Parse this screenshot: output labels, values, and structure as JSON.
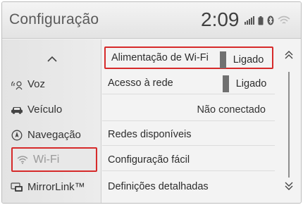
{
  "header": {
    "title": "Configuração",
    "clock": "2:09",
    "status_icons": [
      "signal-bars-icon",
      "battery-icon",
      "bluetooth-icon",
      "wifi-icon"
    ]
  },
  "sidebar": {
    "up_icon": "chevron-up-icon",
    "items": [
      {
        "label": "Voz",
        "icon": "voice-icon",
        "active": false
      },
      {
        "label": "Veículo",
        "icon": "car-icon",
        "active": false
      },
      {
        "label": "Navegação",
        "icon": "navigation-icon",
        "active": false
      },
      {
        "label": "Wi-Fi",
        "icon": "wifi-icon",
        "active": true
      },
      {
        "label": "MirrorLink™",
        "icon": "mirrorlink-icon",
        "active": false
      }
    ]
  },
  "list": {
    "rows": [
      {
        "label": "Alimentação de Wi-Fi",
        "toggle": "Ligado"
      },
      {
        "label": "Acesso à rede",
        "toggle": "Ligado"
      },
      {
        "label": "",
        "status": "Não conectado"
      },
      {
        "label": "Redes disponíveis"
      },
      {
        "label": "Configuração fácil"
      },
      {
        "label": "Definições detalhadas"
      }
    ]
  },
  "scroll": {
    "up_icon": "double-chevron-up-icon",
    "down_icon": "double-chevron-down-icon"
  },
  "colors": {
    "highlight": "#d62a2a",
    "toggle_bar": "#707070"
  }
}
